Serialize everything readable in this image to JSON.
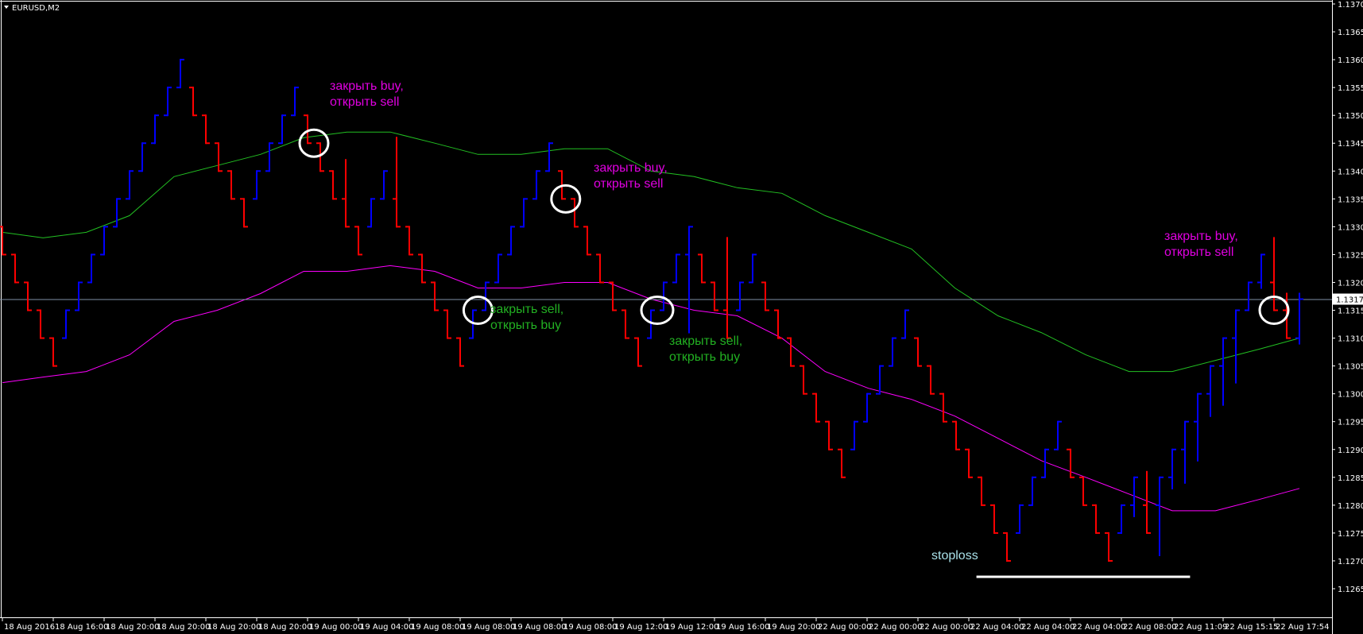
{
  "window": {
    "title": "EURUSD,M2"
  },
  "colors": {
    "background": "#000000",
    "up_bar": "#0000ff",
    "down_bar": "#ff0000",
    "upper_ma": "#22c022",
    "lower_ma": "#ff00ff",
    "current_price_line": "#7f8fa6",
    "stoploss_line": "#ffffff",
    "note_sell": "#e000e0",
    "note_buy": "#22b022",
    "note_stoploss": "#a8e0e8"
  },
  "chart_data": {
    "type": "bar",
    "style": "ohlc",
    "symbol": "EURUSD",
    "timeframe": "M2",
    "ylim": [
      1.1262,
      1.1371
    ],
    "y_ticks": [
      "1.1370",
      "1.1365",
      "1.1360",
      "1.1355",
      "1.1350",
      "1.1345",
      "1.1340",
      "1.1335",
      "1.1330",
      "1.1325",
      "1.1320",
      "1.1315",
      "1.1310",
      "1.1305",
      "1.1300",
      "1.1295",
      "1.1290",
      "1.1285",
      "1.1280",
      "1.1275",
      "1.1270",
      "1.1265"
    ],
    "x_tick_labels": [
      "18 Aug 2016",
      "18 Aug 16:00",
      "18 Aug 20:00",
      "18 Aug 20:00",
      "18 Aug 20:00",
      "18 Aug 20:00",
      "19 Aug 00:00",
      "19 Aug 04:00",
      "19 Aug 08:00",
      "19 Aug 08:00",
      "19 Aug 08:00",
      "19 Aug 08:00",
      "19 Aug 12:00",
      "19 Aug 12:00",
      "19 Aug 16:00",
      "19 Aug 20:00",
      "22 Aug 00:00",
      "22 Aug 00:00",
      "22 Aug 00:00",
      "22 Aug 04:00",
      "22 Aug 04:00",
      "22 Aug 04:00",
      "22 Aug 08:00",
      "22 Aug 11:09",
      "22 Aug 15:15",
      "22 Aug 17:54"
    ],
    "current_price": "1.1317",
    "bars": [
      {
        "o": 1.133,
        "c": 1.1325
      },
      {
        "o": 1.1325,
        "c": 1.132
      },
      {
        "o": 1.132,
        "c": 1.1315
      },
      {
        "o": 1.1315,
        "c": 1.131
      },
      {
        "o": 1.131,
        "c": 1.1305
      },
      {
        "o": 1.131,
        "c": 1.1315
      },
      {
        "o": 1.1315,
        "c": 1.132
      },
      {
        "o": 1.132,
        "c": 1.1325
      },
      {
        "o": 1.1325,
        "c": 1.133
      },
      {
        "o": 1.133,
        "c": 1.1335
      },
      {
        "o": 1.1335,
        "c": 1.134
      },
      {
        "o": 1.134,
        "c": 1.1345
      },
      {
        "o": 1.1345,
        "c": 1.135
      },
      {
        "o": 1.135,
        "c": 1.1355
      },
      {
        "o": 1.1355,
        "c": 1.136
      },
      {
        "o": 1.1355,
        "c": 1.135
      },
      {
        "o": 1.135,
        "c": 1.1345
      },
      {
        "o": 1.1345,
        "c": 1.134
      },
      {
        "o": 1.134,
        "c": 1.1335
      },
      {
        "o": 1.1335,
        "c": 1.133
      },
      {
        "o": 1.1335,
        "c": 1.134
      },
      {
        "o": 1.134,
        "c": 1.1345
      },
      {
        "o": 1.1345,
        "c": 1.135
      },
      {
        "o": 1.135,
        "c": 1.1355
      },
      {
        "o": 1.135,
        "c": 1.1345
      },
      {
        "o": 1.1345,
        "c": 1.134
      },
      {
        "o": 1.134,
        "c": 1.1335
      },
      {
        "o": 1.1335,
        "c": 1.133,
        "h": 1.1342
      },
      {
        "o": 1.133,
        "c": 1.1325
      },
      {
        "o": 1.133,
        "c": 1.1335
      },
      {
        "o": 1.1335,
        "c": 1.134
      },
      {
        "o": 1.1335,
        "c": 1.133,
        "h": 1.1346
      },
      {
        "o": 1.133,
        "c": 1.1325
      },
      {
        "o": 1.1325,
        "c": 1.132
      },
      {
        "o": 1.132,
        "c": 1.1315
      },
      {
        "o": 1.1315,
        "c": 1.131
      },
      {
        "o": 1.131,
        "c": 1.1305
      },
      {
        "o": 1.131,
        "c": 1.1315
      },
      {
        "o": 1.1315,
        "c": 1.132
      },
      {
        "o": 1.132,
        "c": 1.1325
      },
      {
        "o": 1.1325,
        "c": 1.133
      },
      {
        "o": 1.133,
        "c": 1.1335
      },
      {
        "o": 1.1335,
        "c": 1.134
      },
      {
        "o": 1.134,
        "c": 1.1345
      },
      {
        "o": 1.134,
        "c": 1.1335
      },
      {
        "o": 1.1335,
        "c": 1.133
      },
      {
        "o": 1.133,
        "c": 1.1325
      },
      {
        "o": 1.1325,
        "c": 1.132
      },
      {
        "o": 1.132,
        "c": 1.1315
      },
      {
        "o": 1.1315,
        "c": 1.131
      },
      {
        "o": 1.131,
        "c": 1.1305
      },
      {
        "o": 1.131,
        "c": 1.1315
      },
      {
        "o": 1.1315,
        "c": 1.132
      },
      {
        "o": 1.132,
        "c": 1.1325
      },
      {
        "o": 1.1325,
        "c": 1.133,
        "l": 1.1311
      },
      {
        "o": 1.1325,
        "c": 1.132
      },
      {
        "o": 1.132,
        "c": 1.1315
      },
      {
        "o": 1.1315,
        "c": 1.131,
        "h": 1.1328
      },
      {
        "o": 1.1315,
        "c": 1.132
      },
      {
        "o": 1.132,
        "c": 1.1325
      },
      {
        "o": 1.132,
        "c": 1.1315
      },
      {
        "o": 1.1315,
        "c": 1.131
      },
      {
        "o": 1.131,
        "c": 1.1305
      },
      {
        "o": 1.1305,
        "c": 1.13
      },
      {
        "o": 1.13,
        "c": 1.1295
      },
      {
        "o": 1.1295,
        "c": 1.129
      },
      {
        "o": 1.129,
        "c": 1.1285
      },
      {
        "o": 1.129,
        "c": 1.1295
      },
      {
        "o": 1.1295,
        "c": 1.13
      },
      {
        "o": 1.13,
        "c": 1.1305
      },
      {
        "o": 1.1305,
        "c": 1.131
      },
      {
        "o": 1.131,
        "c": 1.1315
      },
      {
        "o": 1.131,
        "c": 1.1305
      },
      {
        "o": 1.1305,
        "c": 1.13
      },
      {
        "o": 1.13,
        "c": 1.1295
      },
      {
        "o": 1.1295,
        "c": 1.129
      },
      {
        "o": 1.129,
        "c": 1.1285
      },
      {
        "o": 1.1285,
        "c": 1.128
      },
      {
        "o": 1.128,
        "c": 1.1275
      },
      {
        "o": 1.1275,
        "c": 1.127
      },
      {
        "o": 1.1275,
        "c": 1.128
      },
      {
        "o": 1.128,
        "c": 1.1285
      },
      {
        "o": 1.1285,
        "c": 1.129
      },
      {
        "o": 1.129,
        "c": 1.1295
      },
      {
        "o": 1.129,
        "c": 1.1285
      },
      {
        "o": 1.1285,
        "c": 1.128
      },
      {
        "o": 1.128,
        "c": 1.1275
      },
      {
        "o": 1.1275,
        "c": 1.127
      },
      {
        "o": 1.1275,
        "c": 1.128
      },
      {
        "o": 1.128,
        "c": 1.1285,
        "l": 1.1278
      },
      {
        "o": 1.128,
        "c": 1.1275,
        "h": 1.1286
      },
      {
        "o": 1.128,
        "c": 1.1285,
        "l": 1.1271
      },
      {
        "o": 1.1285,
        "c": 1.129,
        "l": 1.1283
      },
      {
        "o": 1.129,
        "c": 1.1295,
        "l": 1.1284
      },
      {
        "o": 1.1295,
        "c": 1.13,
        "l": 1.1288
      },
      {
        "o": 1.13,
        "c": 1.1305,
        "l": 1.1296
      },
      {
        "o": 1.1305,
        "c": 1.131,
        "l": 1.1298
      },
      {
        "o": 1.131,
        "c": 1.1315,
        "l": 1.1302
      },
      {
        "o": 1.1315,
        "c": 1.132
      },
      {
        "o": 1.132,
        "c": 1.1325,
        "l": 1.1319
      },
      {
        "o": 1.132,
        "c": 1.1315,
        "h": 1.1328
      },
      {
        "o": 1.1315,
        "c": 1.131,
        "h": 1.1318
      },
      {
        "o": 1.131,
        "c": 1.1317,
        "h": 1.1318,
        "l": 1.1309
      }
    ],
    "upper_ma": [
      [
        0,
        1.1329
      ],
      [
        3.2,
        1.1328
      ],
      [
        6.6,
        1.1329
      ],
      [
        10,
        1.1332
      ],
      [
        13.5,
        1.1339
      ],
      [
        16.9,
        1.1341
      ],
      [
        20.3,
        1.1343
      ],
      [
        23.7,
        1.1346
      ],
      [
        27.1,
        1.1347
      ],
      [
        30.5,
        1.1347
      ],
      [
        34,
        1.1345
      ],
      [
        37.4,
        1.1343
      ],
      [
        40.8,
        1.1343
      ],
      [
        44.2,
        1.1344
      ],
      [
        47.6,
        1.1344
      ],
      [
        51,
        1.134
      ],
      [
        54.4,
        1.1339
      ],
      [
        57.8,
        1.1337
      ],
      [
        61.3,
        1.1336
      ],
      [
        64.7,
        1.1332
      ],
      [
        68.1,
        1.1329
      ],
      [
        71.5,
        1.1326
      ],
      [
        74.9,
        1.1319
      ],
      [
        78.3,
        1.1314
      ],
      [
        81.7,
        1.1311
      ],
      [
        85.2,
        1.1307
      ],
      [
        88.6,
        1.1304
      ],
      [
        92,
        1.1304
      ],
      [
        95.4,
        1.1306
      ],
      [
        98.8,
        1.1308
      ],
      [
        102,
        1.131
      ]
    ],
    "lower_ma": [
      [
        0,
        1.1302
      ],
      [
        3.2,
        1.1303
      ],
      [
        6.6,
        1.1304
      ],
      [
        10,
        1.1307
      ],
      [
        13.5,
        1.1313
      ],
      [
        16.9,
        1.1315
      ],
      [
        20.3,
        1.1318
      ],
      [
        23.7,
        1.1322
      ],
      [
        27.1,
        1.1322
      ],
      [
        30.5,
        1.1323
      ],
      [
        34,
        1.1322
      ],
      [
        37.4,
        1.1319
      ],
      [
        40.8,
        1.1319
      ],
      [
        44.2,
        1.132
      ],
      [
        47.6,
        1.132
      ],
      [
        51,
        1.1317
      ],
      [
        54.4,
        1.1315
      ],
      [
        57.8,
        1.1314
      ],
      [
        61.3,
        1.131
      ],
      [
        64.7,
        1.1304
      ],
      [
        68.1,
        1.1301
      ],
      [
        71.5,
        1.1299
      ],
      [
        74.9,
        1.1296
      ],
      [
        78.3,
        1.1292
      ],
      [
        81.7,
        1.1288
      ],
      [
        85.2,
        1.1285
      ],
      [
        88.6,
        1.1282
      ],
      [
        92,
        1.1279
      ],
      [
        95.4,
        1.1279
      ],
      [
        98.8,
        1.1281
      ],
      [
        102,
        1.1283
      ]
    ],
    "annotations": [
      {
        "lines": [
          "закрыть buy,",
          "открыть sell"
        ],
        "kind": "sell",
        "bar": 24.5,
        "price": 1.1345
      },
      {
        "lines": [
          "закрыть buy,",
          "открыть sell"
        ],
        "kind": "sell",
        "bar": 44.3,
        "price": 1.1335
      },
      {
        "lines": [
          "закрыть sell,",
          "открыть buy"
        ],
        "kind": "buy",
        "bar": 37.4,
        "price": 1.1315
      },
      {
        "lines": [
          "закрыть sell,",
          "открыть buy"
        ],
        "kind": "buy",
        "bar": 51.5,
        "price": 1.1315
      },
      {
        "lines": [
          "закрыть buy,",
          "открыть sell"
        ],
        "kind": "sell",
        "bar": 100,
        "price": 1.1315
      }
    ],
    "stoploss": {
      "label": "stoploss",
      "price": 1.1268,
      "from_bar": 76.6,
      "to_bar": 93.4
    }
  }
}
